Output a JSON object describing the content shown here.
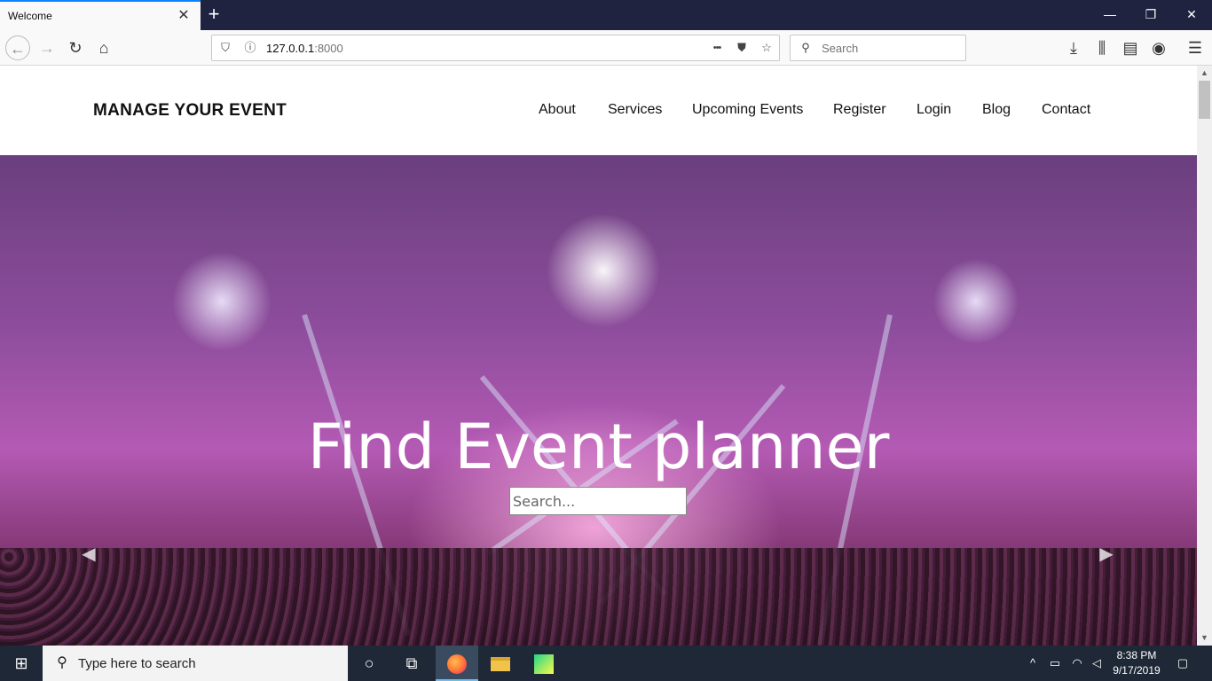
{
  "browser": {
    "tab_title": "Welcome",
    "url_host": "127.0.0.1",
    "url_port": ":8000",
    "search_placeholder": "Search",
    "more_label": "•••"
  },
  "site": {
    "brand": "MANAGE YOUR EVENT",
    "nav": [
      "About",
      "Services",
      "Upcoming Events",
      "Register",
      "Login",
      "Blog",
      "Contact"
    ],
    "hero_title": "Find Event planner",
    "hero_search_placeholder": "Search..."
  },
  "taskbar": {
    "search_text": "Type here to search",
    "time": "8:38 PM",
    "date": "9/17/2019"
  },
  "colors": {
    "titlebar": "#202340",
    "accent": "#0a84ff",
    "taskbar": "#1e2836"
  }
}
